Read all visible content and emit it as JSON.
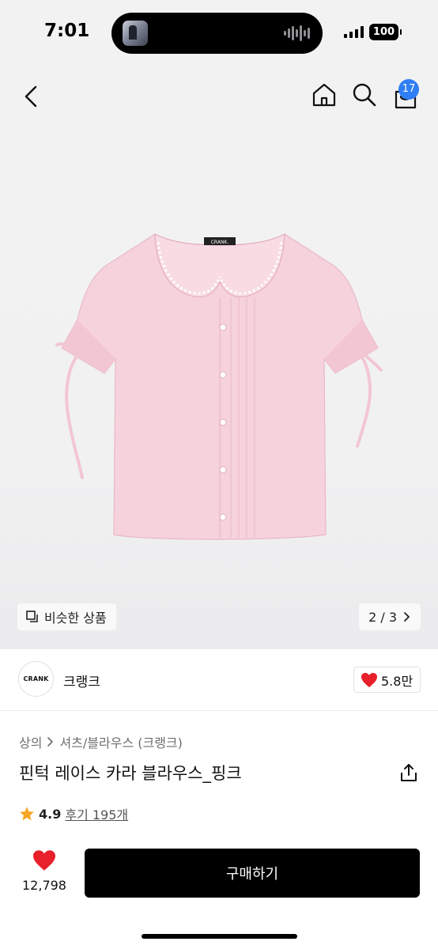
{
  "status_bar": {
    "time": "7:01",
    "battery": "100"
  },
  "header": {
    "cart_count": "17"
  },
  "gallery": {
    "similar_label": "비슷한 상품",
    "pager": "2 / 3",
    "shirt_tag_text": "CRANK."
  },
  "brand": {
    "logo_text": "CRANK",
    "name": "크랭크",
    "likes": "5.8만"
  },
  "product": {
    "breadcrumb": [
      "상의",
      "셔츠/블라우스 (크랭크)"
    ],
    "title": "핀턱 레이스 카라 블라우스_핑크",
    "rating": "4.9",
    "reviews": "후기 195개"
  },
  "bottom_bar": {
    "like_count": "12,798",
    "buy_label": "구매하기"
  },
  "colors": {
    "accent_badge": "#2f7ef5",
    "like_heart": "#e8202a",
    "rating_star": "#f5a623",
    "buy_button": "#000000",
    "blouse_pink": "#f6d2dc"
  },
  "icons": [
    "back-chevron-icon",
    "home-icon",
    "search-icon",
    "shopping-bag-icon",
    "copy-icon",
    "chevron-right-icon",
    "heart-icon",
    "share-icon",
    "star-icon"
  ]
}
